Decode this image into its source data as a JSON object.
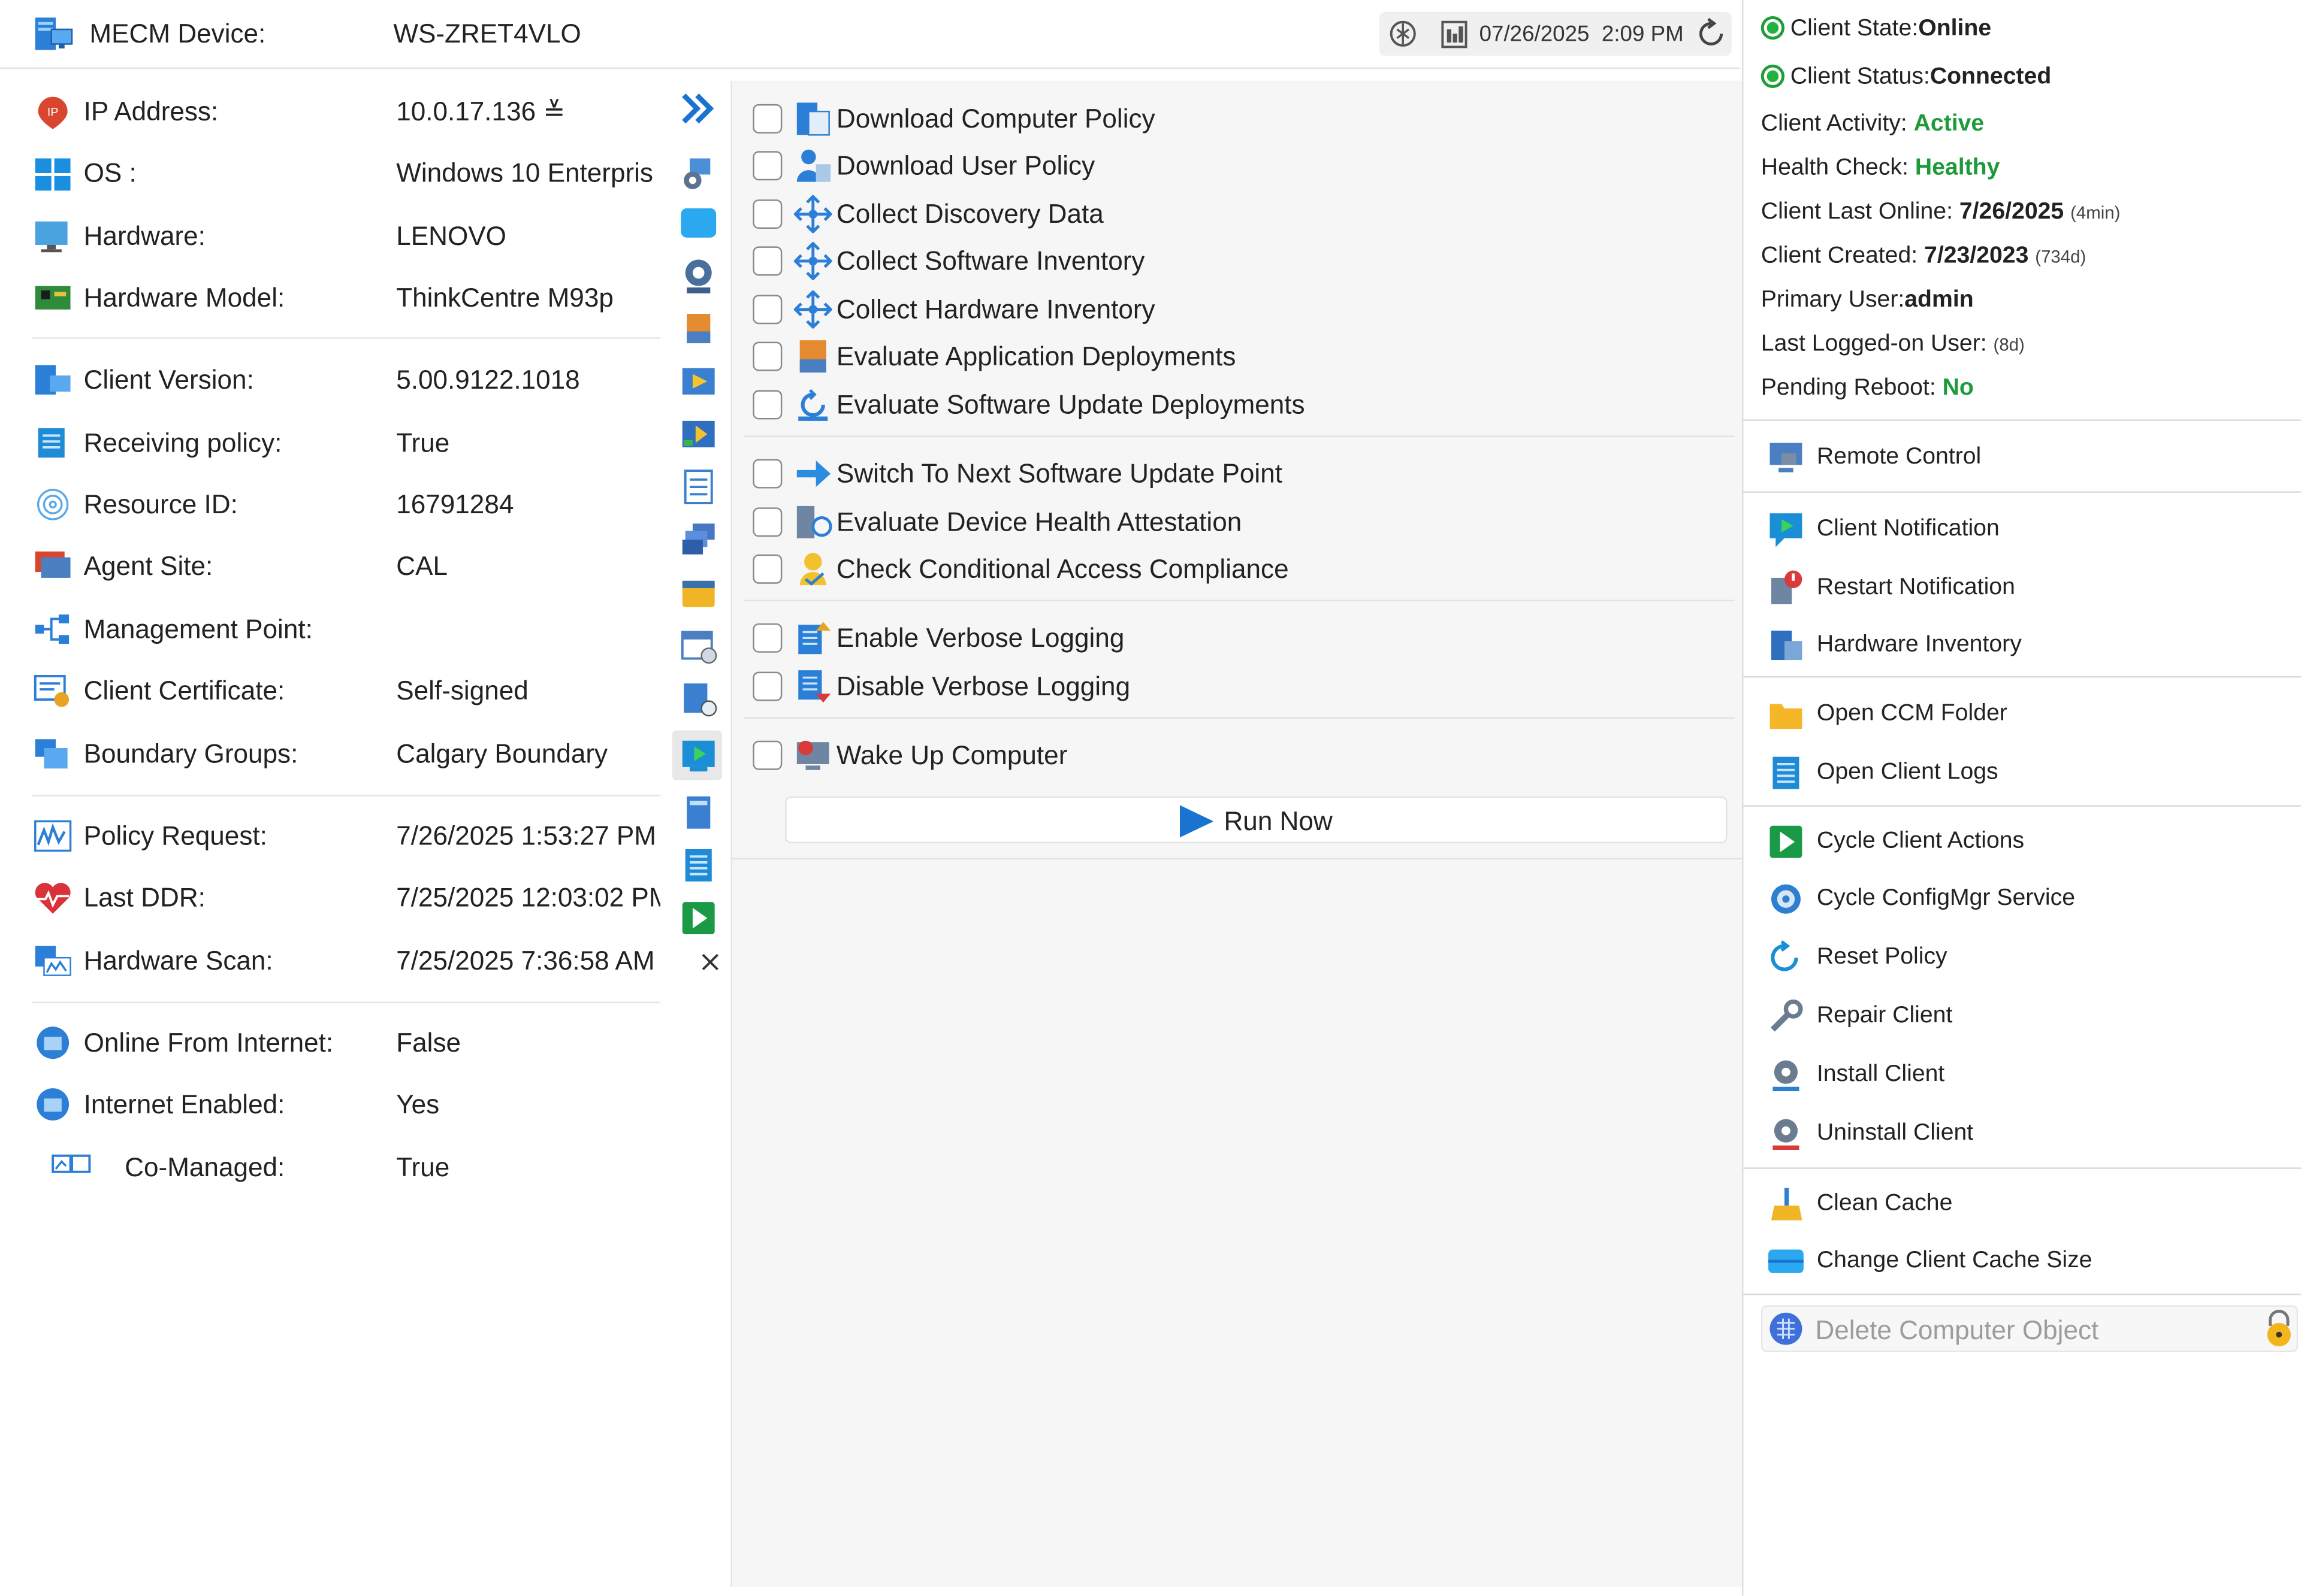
{
  "header": {
    "label": "MECM Device:",
    "value": "WS-ZRET4VLO",
    "date": "07/26/2025",
    "time": "2:09 PM"
  },
  "info": [
    {
      "label": "IP Address:",
      "value": "10.0.17.136 ≚",
      "icon": "ip-pin-icon"
    },
    {
      "label": "OS :",
      "value": "Windows 10 Enterpris",
      "icon": "windows-logo-icon"
    },
    {
      "label": "Hardware:",
      "value": "LENOVO",
      "icon": "computer-icon"
    },
    {
      "label": "Hardware Model:",
      "value": "ThinkCentre M93p",
      "icon": "motherboard-icon"
    },
    {
      "label": "Client Version:",
      "value": "5.00.9122.1018",
      "icon": "client-version-icon"
    },
    {
      "label": "Receiving policy:",
      "value": "True",
      "icon": "policy-list-icon"
    },
    {
      "label": "Resource ID:",
      "value": "16791284",
      "icon": "fingerprint-icon"
    },
    {
      "label": "Agent Site:",
      "value": "CAL",
      "icon": "agent-site-icon"
    },
    {
      "label": "Management Point:",
      "value": "",
      "icon": "management-point-icon"
    },
    {
      "label": "Client Certificate:",
      "value": "Self-signed",
      "icon": "certificate-icon"
    },
    {
      "label": "Boundary Groups:",
      "value": "Calgary Boundary",
      "icon": "boundary-groups-icon"
    },
    {
      "label": "Policy Request:",
      "value": "7/26/2025 1:53:27 PM",
      "icon": "policy-chart-icon"
    },
    {
      "label": "Last DDR:",
      "value": "7/25/2025 12:03:02 PM",
      "icon": "heartbeat-icon"
    },
    {
      "label": "Hardware Scan:",
      "value": "7/25/2025 7:36:58 AM",
      "icon": "hardware-scan-icon"
    },
    {
      "label": "Online From Internet:",
      "value": "False",
      "icon": "globe-computer-icon"
    },
    {
      "label": "Internet Enabled:",
      "value": "Yes",
      "icon": "globe-computer-icon"
    },
    {
      "label": "Co-Managed:",
      "value": "True",
      "icon": "co-managed-icon"
    }
  ],
  "actions": [
    {
      "label": "Download Computer Policy",
      "icon": "computer-policy-icon"
    },
    {
      "label": "Download User Policy",
      "icon": "user-policy-icon"
    },
    {
      "label": "Collect Discovery Data",
      "icon": "discovery-arrows-icon"
    },
    {
      "label": "Collect Software Inventory",
      "icon": "discovery-arrows-icon"
    },
    {
      "label": "Collect Hardware Inventory",
      "icon": "discovery-arrows-icon"
    },
    {
      "label": "Evaluate Application Deployments",
      "icon": "package-icon"
    },
    {
      "label": "Evaluate Software Update Deployments",
      "icon": "software-update-icon"
    },
    {
      "label": "Switch To Next Software Update Point",
      "icon": "arrow-right-icon"
    },
    {
      "label": "Evaluate Device Health Attestation",
      "icon": "health-attestation-icon"
    },
    {
      "label": "Check Conditional Access Compliance",
      "icon": "compliance-icon"
    },
    {
      "label": "Enable Verbose Logging",
      "icon": "log-up-icon"
    },
    {
      "label": "Disable Verbose Logging",
      "icon": "log-down-icon"
    },
    {
      "label": "Wake Up Computer",
      "icon": "wake-computer-icon"
    }
  ],
  "run_now": "Run Now",
  "status": {
    "state_label": "Client State:",
    "state_value": "Online",
    "status_label": "Client Status:",
    "status_value": "Connected",
    "activity_label": "Client Activity:",
    "activity_value": "Active",
    "health_label": "Health Check:",
    "health_value": "Healthy",
    "last_online_label": "Client Last Online:",
    "last_online_value": "7/26/2025",
    "last_online_age": "(4min)",
    "created_label": "Client Created:",
    "created_value": "7/23/2023",
    "created_age": "(734d)",
    "primary_user_label": "Primary User:",
    "primary_user_value": "admin",
    "last_logged_label": "Last Logged-on User:",
    "last_logged_age": "(8d)",
    "reboot_label": "Pending Reboot:",
    "reboot_value": "No"
  },
  "right_actions": {
    "remote_control": "Remote Control",
    "client_notification": "Client Notification",
    "restart_notification": "Restart Notification",
    "hardware_inventory": "Hardware Inventory",
    "open_ccm_folder": "Open CCM Folder",
    "open_client_logs": "Open Client Logs",
    "cycle_client_actions": "Cycle Client Actions",
    "cycle_configmgr_service": "Cycle ConfigMgr Service",
    "reset_policy": "Reset Policy",
    "repair_client": "Repair Client",
    "install_client": "Install Client",
    "uninstall_client": "Uninstall Client",
    "clean_cache": "Clean Cache",
    "change_cache_size": "Change Client Cache Size",
    "delete_computer_object": "Delete Computer Object"
  },
  "colors": {
    "accent_blue": "#1a73d1",
    "status_green": "#1e9a3a",
    "panel_gray": "#f6f6f6"
  }
}
